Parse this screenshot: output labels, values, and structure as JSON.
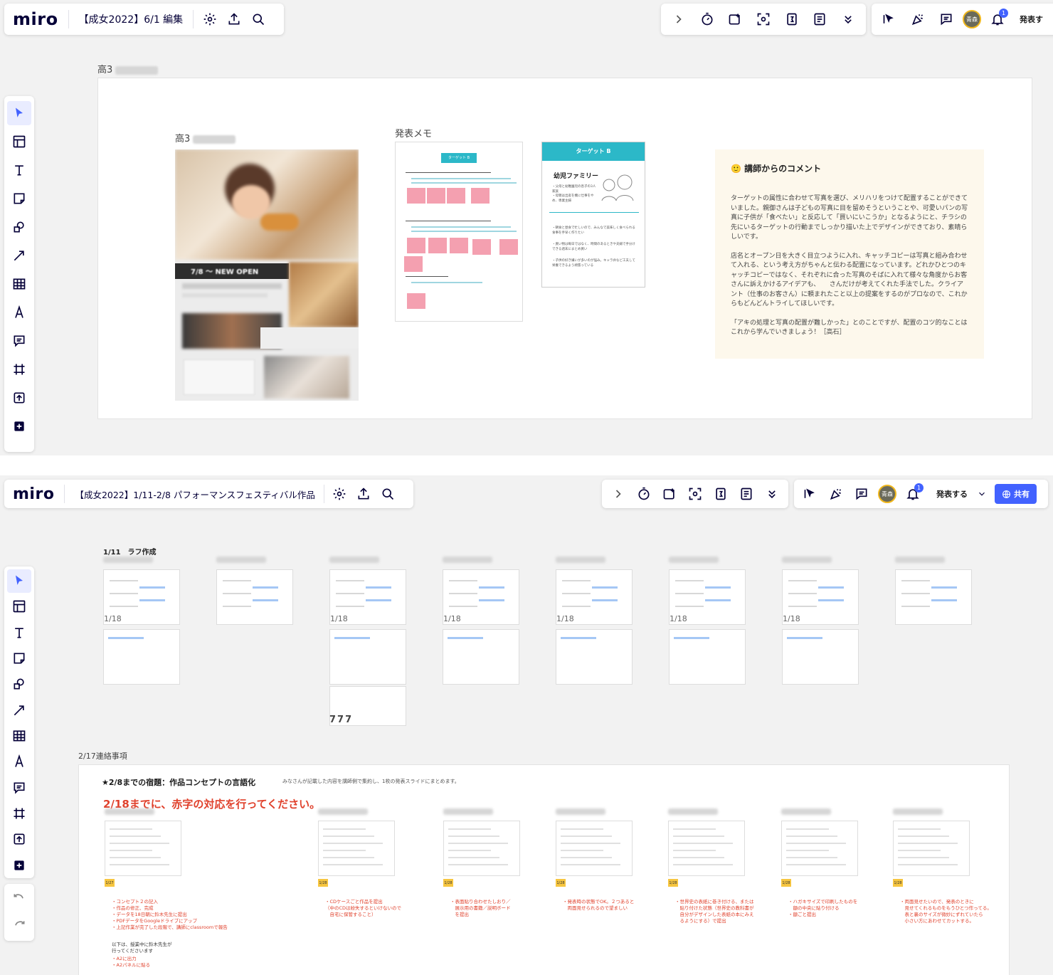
{
  "pane1": {
    "logo": "miro",
    "board_title": "【成女2022】6/1 編集",
    "present_label": "発表す",
    "notif_count": "1",
    "avatar_text": "青森",
    "frame_label": "高3",
    "card_label": "高3",
    "memo_label": "発表メモ",
    "flyer_text": "7/8 〜 NEW OPEN",
    "memo_doc_header": "ターゲット B",
    "target_header": "ターゲット B",
    "target_title": "幼児ファミリー",
    "target_lines": [
      "・父母と幼稚園児の息子の3人家族",
      "・母親は出産を機に仕事をやめ、専業主婦",
      "・朝食と昼食で忙しいので、みんなで美味しく食べられる食事を手早く作りたい",
      "・買い物は毎日ではなく、時間のあるときや夫婦で手分けできる週末にまとめ買い",
      "・子供の好き嫌いが多いのが悩み。キャラ弁など工夫して栄養できるよう頑張っている"
    ],
    "comment_title": "講師からのコメント",
    "comment_paragraphs": [
      "ターゲットの属性に合わせて写真を選び、メリハリをつけて配置することができていました。親御さんは子どもの写真に目を留めそうということや、可愛いパンの写真に子供が「食べたい」と反応して「買いにいこうか」となるようにと、チラシの先にいるターゲットの行動までしっかり描いた上でデザインができており、素晴らしいです。",
      "店名とオープン日を大きく目立つように入れ、キャッチコピーは写真と組み合わせて入れる、という考え方がちゃんと伝わる配置になっています。どれかひとつのキャッチコピーではなく、それぞれに合った写真のそばに入れて様々な角度からお客さんに訴えかけるアイデアも、　　さんだけが考えてくれた手法でした。クライアント（仕事のお客さん）に頼まれたこと以上の提案をするのがプロなので、これからもどんどんトライしてほしいです。",
      "「アキの処理と写真の配置が難しかった」とのことですが、配置のコツ的なことはこれから学んでいきましょう！［高石］"
    ]
  },
  "pane2": {
    "logo": "miro",
    "board_title": "【成女2022】1/11-2/8 パフォーマンスフェスティバル作品",
    "present_label": "発表する",
    "share_label": "共有",
    "notif_count": "1",
    "avatar_text": "青森",
    "section1_label": "1/11　ラフ作成",
    "thumb_date": "1/18",
    "pager_text": "777",
    "section2_label": "2/17連絡事項",
    "homework_title": "★2/8までの宿題：作品コンセプトの言語化",
    "homework_note": "みなさんが記載した内容を講師側で集約し、1枚の発表スライドにまとめます。",
    "deadline_text": "2/18までに、赤字の対応を行ってください。",
    "slide_tags": [
      "1/27",
      "1/28",
      "1/28",
      "1/28",
      "1/28",
      "1/28",
      "1/28"
    ],
    "red_notes": [
      "・コンセプト２の記入\n・作品の修正、完成\n・データを18日朝に鈴木先生に提出\n・PDFデータをGoogleドライブにアップ\n・上記作業が完了した段階で、講師にclassroomで報告",
      "・CDケースごと作品を提出\n（中のCDは紛失するといけないので\n　自宅に保管すること）",
      "・表面貼り合わせたしおり／\n　展示用の書籍／説明ボード\n　を提出",
      "・発表時の状態でOK。２つあると\n　両面見せられるので望ましい",
      "・世界史の表紙に巻き付ける、または\n　貼り付けた状態（世界史の教科書が\n　自分がデザインした表紙の本にみえ\n　るようにする）で提出",
      "・ハガキサイズで印刷したものを\n　額の中央に貼り付ける\n・額ごと提出",
      "・両面見せたいので、発表のときに\n　見せてくれるものをもうひとつ作ってる。\n　表と裏のサイズが微妙にずれていたら\n　小さい方にあわせてカットする。"
    ],
    "black_note": "以下は、授業中に鈴木先生が\n行ってくださいます",
    "red_notes_extra": "・A2に出力\n・A2パネルに貼る"
  }
}
